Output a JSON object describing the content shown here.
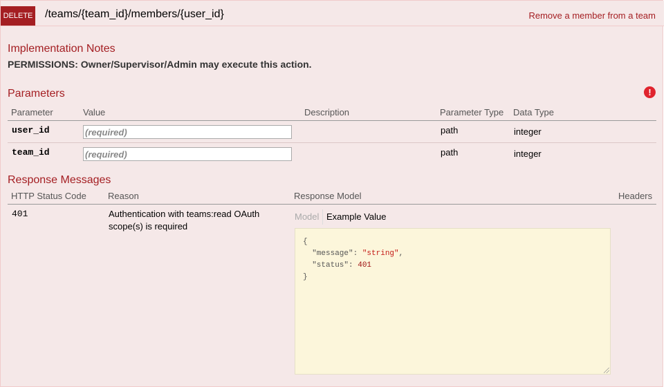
{
  "operation": {
    "method": "DELETE",
    "path": "/teams/{team_id}/members/{user_id}",
    "summary": "Remove a member from a team"
  },
  "implementation_notes": {
    "title": "Implementation Notes",
    "text": "PERMISSIONS: Owner/Supervisor/Admin may execute this action."
  },
  "parameters": {
    "title": "Parameters",
    "error_icon": "exclamation-circle-icon",
    "headers": [
      "Parameter",
      "Value",
      "Description",
      "Parameter Type",
      "Data Type"
    ],
    "rows": [
      {
        "name": "user_id",
        "placeholder": "(required)",
        "description": "",
        "param_type": "path",
        "data_type": "integer"
      },
      {
        "name": "team_id",
        "placeholder": "(required)",
        "description": "",
        "param_type": "path",
        "data_type": "integer"
      }
    ]
  },
  "responses": {
    "title": "Response Messages",
    "headers": [
      "HTTP Status Code",
      "Reason",
      "Response Model",
      "Headers"
    ],
    "rows": [
      {
        "code": "401",
        "reason": "Authentication with teams:read OAuth scope(s) is required",
        "tabs": {
          "model": "Model",
          "example": "Example Value"
        },
        "example": {
          "open": "{",
          "message_key": "\"message\"",
          "message_val": "\"string\"",
          "status_key": "\"status\"",
          "status_val": "401",
          "close": "}"
        }
      }
    ]
  },
  "colors": {
    "accent": "#a41e22",
    "background": "#f5e8e8",
    "sample_bg": "#fcf6db"
  }
}
